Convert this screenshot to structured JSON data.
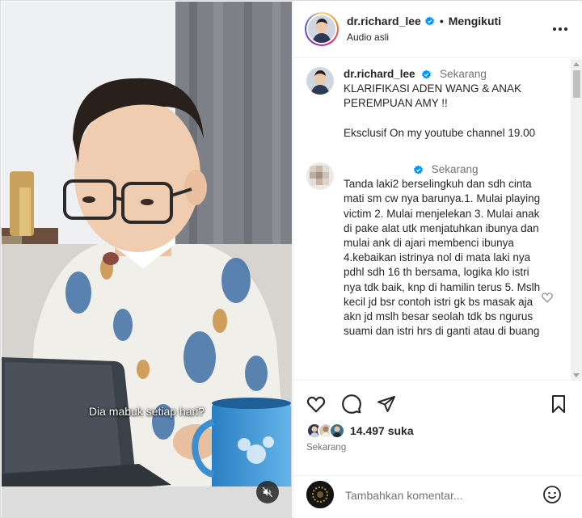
{
  "video": {
    "subtitle": "Dia mabuk setiap hari?",
    "mute_icon": "speaker-muted-icon"
  },
  "header": {
    "username": "dr.richard_lee",
    "separator": "•",
    "follow_label": "Mengikuti",
    "audio": "Audio asli",
    "more_icon": "more-horizontal-icon"
  },
  "caption": {
    "username": "dr.richard_lee",
    "time": "Sekarang",
    "text": "KLARIFIKASI ADEN WANG & ANAK PEREMPUAN AMY !!\n\nEksclusif On my youtube channel 19.00"
  },
  "comment": {
    "time": "Sekarang",
    "text": "Tanda laki2 berselingkuh dan sdh cinta mati sm cw nya barunya.1. Mulai playing victim 2. Mulai menjelekan 3. Mulai anak di pake alat utk menjatuhkan ibunya dan mulai ank di ajari membenci ibunya 4.kebaikan istrinya nol di mata laki nya pdhl sdh 16 th bersama, logika klo istri nya tdk baik, knp di hamilin terus 5. Mslh kecil jd bsr contoh istri gk bs masak aja akn jd mslh besar seolah tdk bs ngurus suami dan istri hrs di ganti atau di buang"
  },
  "actions": {
    "like_icon": "heart-icon",
    "comment_icon": "comment-bubble-icon",
    "share_icon": "paper-plane-icon",
    "save_icon": "bookmark-icon",
    "likes": "14.497 suka",
    "post_time": "Sekarang"
  },
  "add_comment": {
    "placeholder": "Tambahkan komentar...",
    "emoji_icon": "emoji-smile-icon"
  },
  "colors": {
    "verified_blue": "#0095f6",
    "text_primary": "#262626",
    "text_secondary": "#737373",
    "divider": "#efefef"
  }
}
